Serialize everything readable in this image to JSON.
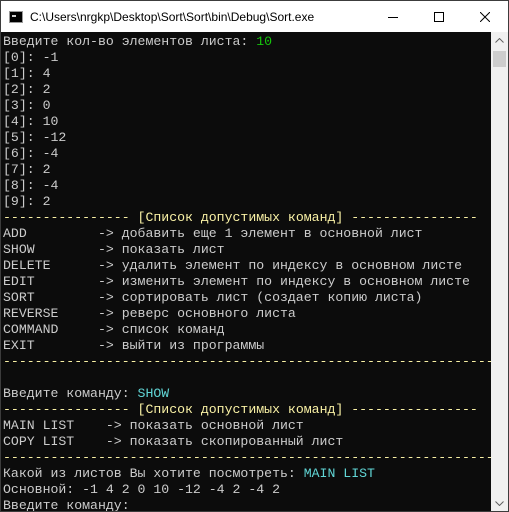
{
  "window": {
    "title": "C:\\Users\\nrgkp\\Desktop\\Sort\\Sort\\bin\\Debug\\Sort.exe"
  },
  "console": {
    "prompt_count": "Введите кол-во элементов листа: ",
    "count_value": "10",
    "elements": [
      "[0]: -1",
      "[1]: 4",
      "[2]: 2",
      "[3]: 0",
      "[4]: 10",
      "[5]: -12",
      "[6]: -4",
      "[7]: 2",
      "[8]: -4",
      "[9]: 2"
    ],
    "commands_header_left": "---------------- ",
    "commands_header_title": "[Список допустимых команд]",
    "commands_header_right": " ----------------",
    "commands": [
      "ADD         -> добавить еще 1 элемент в основной лист",
      "SHOW        -> показать лист",
      "DELETE      -> удалить элемент по индексу в основном листе",
      "EDIT        -> изменить элемент по индексу в основном листе",
      "SORT        -> сортировать лист (создает копию листа)",
      "REVERSE     -> реверс основного листа",
      "COMMAND     -> список команд",
      "EXIT        -> выйти из программы"
    ],
    "separator": "--------------------------------------------------------------------",
    "empty_line": " ",
    "prompt_command": "Введите команду: ",
    "command_value": "SHOW",
    "show_header_left": "---------------- ",
    "show_header_title": "[Список допустимых команд]",
    "show_header_right": " ----------------",
    "show_options": [
      "MAIN LIST    -> показать основной лист",
      "COPY LIST    -> показать скопированный лист"
    ],
    "prompt_which": "Какой из листов Вы хотите посмотреть: ",
    "which_value": "MAIN LIST",
    "main_output": "Основной: -1 4 2 0 10 -12 -4 2 -4 2",
    "prompt_final": "Введите команду:"
  },
  "icons": {
    "app": "console-app-icon",
    "minimize": "minimize-icon",
    "maximize": "maximize-icon",
    "close": "close-icon",
    "scroll_up": "arrow-up-icon",
    "scroll_down": "arrow-down-icon"
  },
  "colors": {
    "console_bg": "#0c0c0c",
    "console_text": "#cccccc",
    "input_green": "#16c60c",
    "header_yellow": "#f9f1a5",
    "input_cyan": "#61d6d6"
  }
}
